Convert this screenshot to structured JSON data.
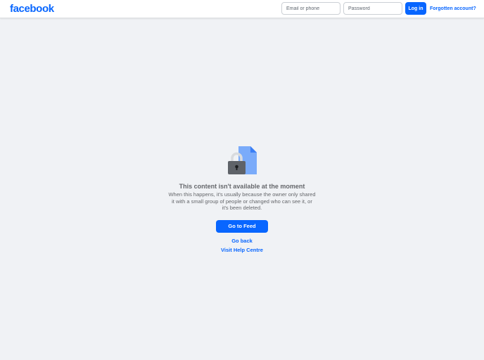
{
  "header": {
    "logo_text": "facebook",
    "email_placeholder": "Email or phone",
    "password_placeholder": "Password",
    "login_label": "Log in",
    "forgot_label": "Forgotten account?"
  },
  "main": {
    "icon": "lock-document-icon",
    "title": "This content isn't available at the moment",
    "description": "When this happens, it's usually because the owner only shared it with a small group of people or changed who can see it, or it's been deleted.",
    "feed_button_label": "Go to Feed",
    "go_back_label": "Go back",
    "help_label": "Visit Help Centre"
  },
  "colors": {
    "brand": "#0866ff",
    "background": "#f0f2f5",
    "text_secondary": "#65676b",
    "document": "#7aabfa",
    "lock": "#5f6369"
  }
}
